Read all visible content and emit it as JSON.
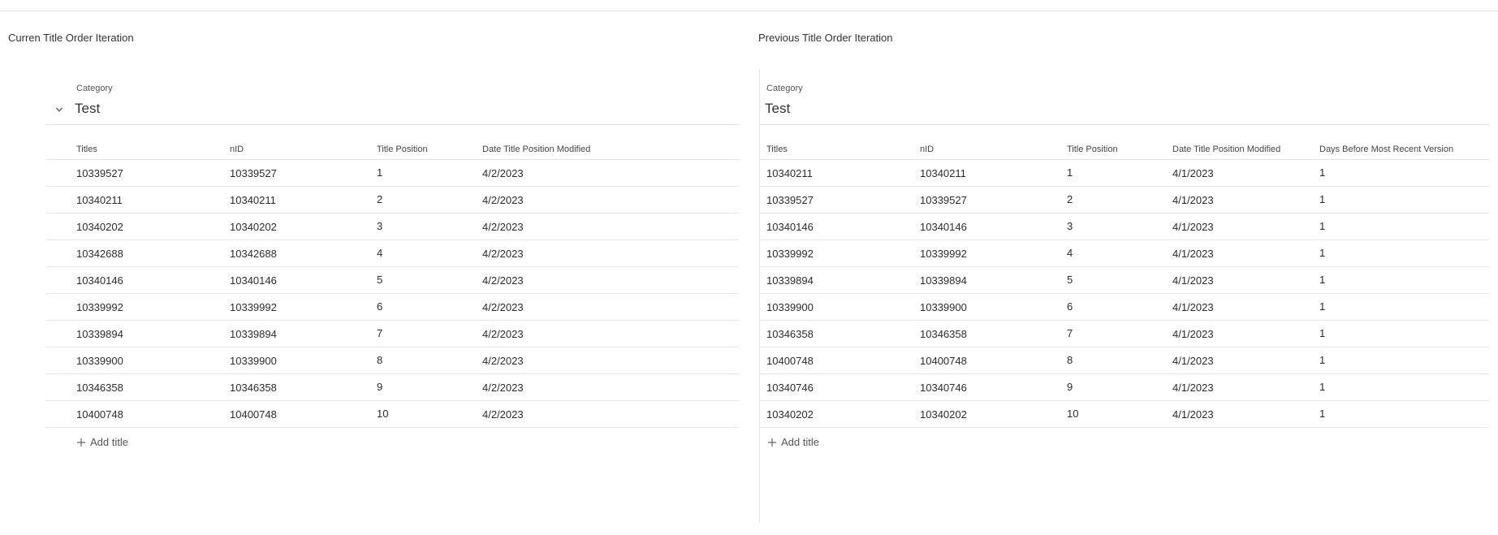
{
  "left_panel": {
    "title": "Curren Title Order Iteration",
    "category_label": "Category",
    "category_value": "Test",
    "columns": [
      "Titles",
      "nID",
      "Title Position",
      "Date Title Position Modified"
    ],
    "rows": [
      [
        "10339527",
        "10339527",
        "1",
        "4/2/2023"
      ],
      [
        "10340211",
        "10340211",
        "2",
        "4/2/2023"
      ],
      [
        "10340202",
        "10340202",
        "3",
        "4/2/2023"
      ],
      [
        "10342688",
        "10342688",
        "4",
        "4/2/2023"
      ],
      [
        "10340146",
        "10340146",
        "5",
        "4/2/2023"
      ],
      [
        "10339992",
        "10339992",
        "6",
        "4/2/2023"
      ],
      [
        "10339894",
        "10339894",
        "7",
        "4/2/2023"
      ],
      [
        "10339900",
        "10339900",
        "8",
        "4/2/2023"
      ],
      [
        "10346358",
        "10346358",
        "9",
        "4/2/2023"
      ],
      [
        "10400748",
        "10400748",
        "10",
        "4/2/2023"
      ]
    ],
    "add_label": "Add title"
  },
  "right_panel": {
    "title": "Previous Title Order Iteration",
    "category_label": "Category",
    "category_value": "Test",
    "columns": [
      "Titles",
      "nID",
      "Title Position",
      "Date Title Position Modified",
      "Days Before Most Recent Version"
    ],
    "rows": [
      [
        "10340211",
        "10340211",
        "1",
        "4/1/2023",
        "1"
      ],
      [
        "10339527",
        "10339527",
        "2",
        "4/1/2023",
        "1"
      ],
      [
        "10340146",
        "10340146",
        "3",
        "4/1/2023",
        "1"
      ],
      [
        "10339992",
        "10339992",
        "4",
        "4/1/2023",
        "1"
      ],
      [
        "10339894",
        "10339894",
        "5",
        "4/1/2023",
        "1"
      ],
      [
        "10339900",
        "10339900",
        "6",
        "4/1/2023",
        "1"
      ],
      [
        "10346358",
        "10346358",
        "7",
        "4/1/2023",
        "1"
      ],
      [
        "10400748",
        "10400748",
        "8",
        "4/1/2023",
        "1"
      ],
      [
        "10340746",
        "10340746",
        "9",
        "4/1/2023",
        "1"
      ],
      [
        "10340202",
        "10340202",
        "10",
        "4/1/2023",
        "1"
      ]
    ],
    "add_label": "Add title"
  },
  "icons": {
    "collapse": "chevron-down-icon",
    "add": "plus-icon"
  }
}
